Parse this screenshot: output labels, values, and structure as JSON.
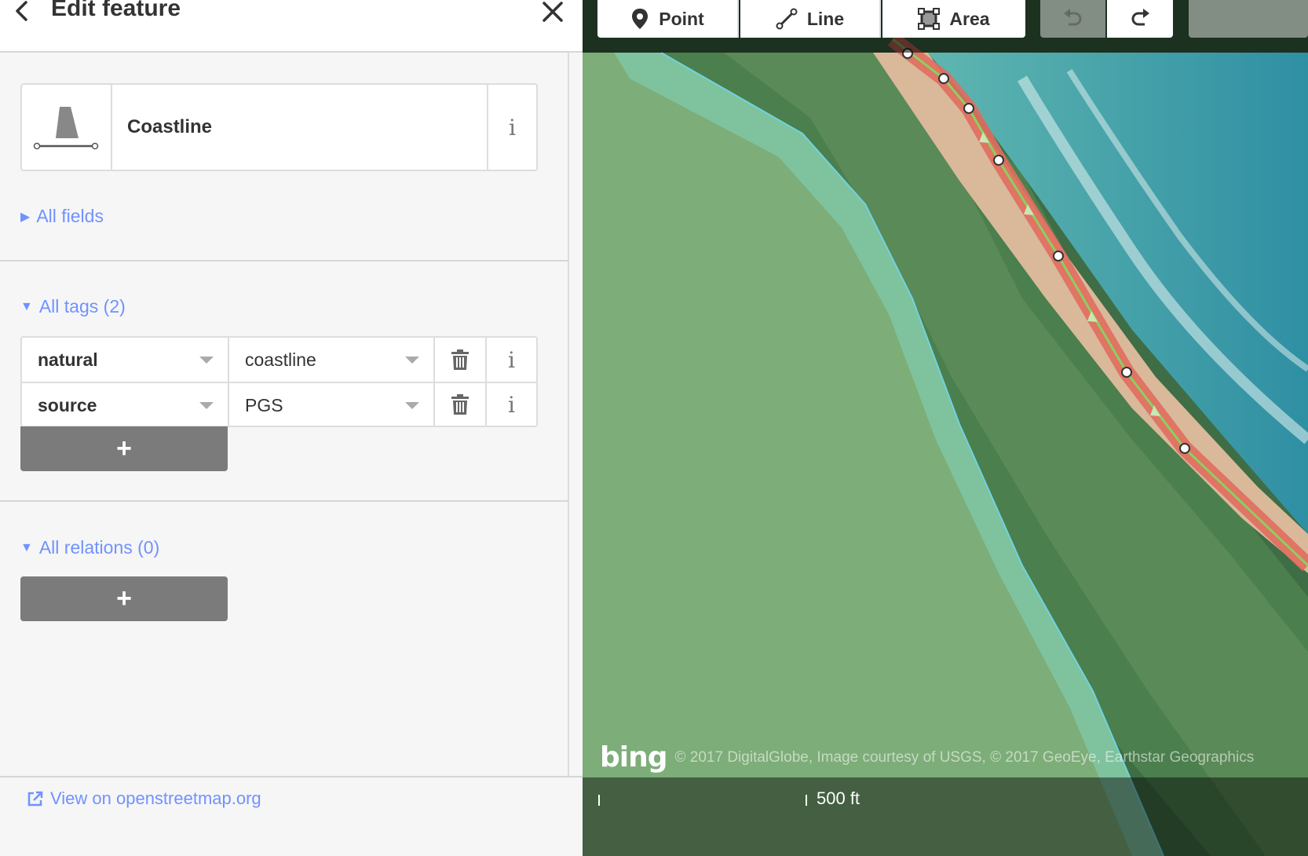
{
  "sidebar": {
    "header": {
      "title": "Edit feature"
    },
    "preset": {
      "name": "Coastline",
      "info": "i"
    },
    "all_fields": {
      "label": "All fields"
    },
    "all_tags": {
      "label": "All tags (2)",
      "tags": [
        {
          "key": "natural",
          "value": "coastline",
          "info": "i"
        },
        {
          "key": "source",
          "value": "PGS",
          "info": "i"
        }
      ],
      "add_label": "+"
    },
    "all_relations": {
      "label": "All relations (0)",
      "add_label": "+"
    },
    "footer": {
      "link": "View on openstreetmap.org"
    }
  },
  "map": {
    "toolbar": {
      "point": "Point",
      "line": "Line",
      "area": "Area"
    },
    "attribution": {
      "logo": "bing",
      "text": "© 2017 DigitalGlobe, Image courtesy of USGS, © 2017 GeoEye, Earthstar Geographics"
    },
    "scale": {
      "label": "500 ft"
    }
  },
  "colors": {
    "accent": "#7092ff",
    "button_gray": "#7b7b7b",
    "line_selected": "#e06d5f",
    "coastline_green": "#8cd05f",
    "area_fill": "#7fc6a4"
  },
  "icons": [
    "back-icon",
    "close-icon",
    "coastline-preset-icon",
    "trash-icon",
    "info-icon",
    "plus-icon",
    "external-link-icon",
    "point-icon",
    "line-icon",
    "area-icon",
    "undo-icon",
    "redo-icon"
  ]
}
